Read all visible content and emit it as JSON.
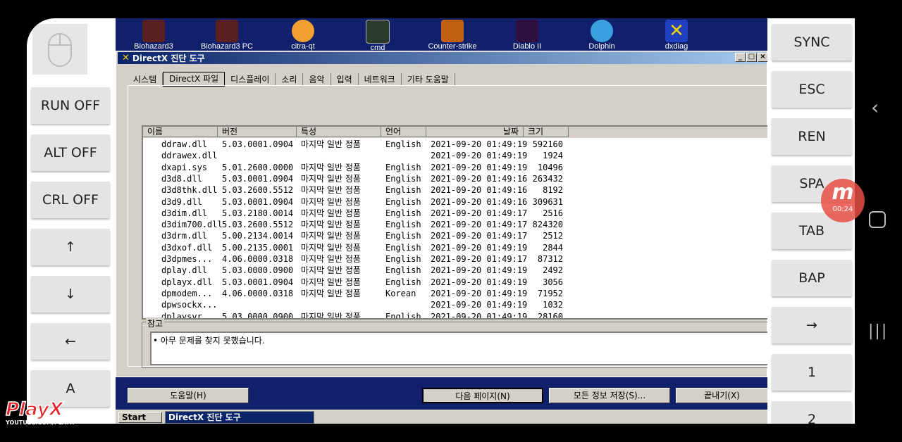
{
  "left_controls": {
    "buttons": [
      "RUN OFF",
      "ALT OFF",
      "CRL OFF",
      "↑",
      "↓",
      "←",
      "A"
    ]
  },
  "right_controls": {
    "buttons": [
      "SYNC",
      "ESC",
      "REN",
      "SPA",
      "TAB",
      "BAP",
      "→",
      "1",
      "2"
    ]
  },
  "desktop_icons": [
    "Biohazard3",
    "Biohazard3 PC",
    "citra-qt",
    "cmd",
    "Counter-strike",
    "Diablo II",
    "Dolphin",
    "dxdiag"
  ],
  "window": {
    "title": "DirectX 진단 도구",
    "tabs": [
      "시스템",
      "DirectX 파일",
      "디스플레이",
      "소리",
      "음악",
      "입력",
      "네트워크",
      "기타 도움말"
    ],
    "active_tab": "DirectX 파일",
    "columns": [
      "이름",
      "버전",
      "특성",
      "언어",
      "날짜",
      "크기"
    ],
    "files": [
      {
        "name": "ddraw.dll",
        "version": "5.03.0001.0904",
        "attr": "마지막 일반 정품",
        "lang": "English",
        "date": "2021-09-20 01:49:19",
        "size": "592160"
      },
      {
        "name": "ddrawex.dll",
        "version": "",
        "attr": "",
        "lang": "",
        "date": "2021-09-20 01:49:19",
        "size": "1924"
      },
      {
        "name": "dxapi.sys",
        "version": "5.01.2600.0000",
        "attr": "마지막 일반 정품",
        "lang": "English",
        "date": "2021-09-20 01:49:19",
        "size": "10496"
      },
      {
        "name": "d3d8.dll",
        "version": "5.03.0001.0904",
        "attr": "마지막 일반 정품",
        "lang": "English",
        "date": "2021-09-20 01:49:16",
        "size": "263432"
      },
      {
        "name": "d3d8thk.dll",
        "version": "5.03.2600.5512",
        "attr": "마지막 일반 정품",
        "lang": "English",
        "date": "2021-09-20 01:49:16",
        "size": "8192"
      },
      {
        "name": "d3d9.dll",
        "version": "5.03.0001.0904",
        "attr": "마지막 일반 정품",
        "lang": "English",
        "date": "2021-09-20 01:49:16",
        "size": "309631"
      },
      {
        "name": "d3dim.dll",
        "version": "5.03.2180.0014",
        "attr": "마지막 일반 정품",
        "lang": "English",
        "date": "2021-09-20 01:49:17",
        "size": "2516"
      },
      {
        "name": "d3dim700.dll",
        "version": "5.03.2600.5512",
        "attr": "마지막 일반 정품",
        "lang": "English",
        "date": "2021-09-20 01:49:17",
        "size": "824320"
      },
      {
        "name": "d3drm.dll",
        "version": "5.00.2134.0014",
        "attr": "마지막 일반 정품",
        "lang": "English",
        "date": "2021-09-20 01:49:17",
        "size": "2512"
      },
      {
        "name": "d3dxof.dll",
        "version": "5.00.2135.0001",
        "attr": "마지막 일반 정품",
        "lang": "English",
        "date": "2021-09-20 01:49:19",
        "size": "2844"
      },
      {
        "name": "d3dpmes...",
        "version": "4.06.0000.0318",
        "attr": "마지막 일반 정품",
        "lang": "English",
        "date": "2021-09-20 01:49:17",
        "size": "87312"
      },
      {
        "name": "dplay.dll",
        "version": "5.03.0000.0900",
        "attr": "마지막 일반 정품",
        "lang": "English",
        "date": "2021-09-20 01:49:19",
        "size": "2492"
      },
      {
        "name": "dplayx.dll",
        "version": "5.03.0001.0904",
        "attr": "마지막 일반 정품",
        "lang": "English",
        "date": "2021-09-20 01:49:19",
        "size": "3056"
      },
      {
        "name": "dpmodem...",
        "version": "4.06.0000.0318",
        "attr": "마지막 일반 정품",
        "lang": "Korean",
        "date": "2021-09-20 01:49:19",
        "size": "71952"
      },
      {
        "name": "dpwsockx...",
        "version": "",
        "attr": "",
        "lang": "",
        "date": "2021-09-20 01:49:19",
        "size": "1032"
      },
      {
        "name": "dplaysvr...",
        "version": "5.03.0000.0900",
        "attr": "마지막 일반 정품",
        "lang": "English",
        "date": "2021-09-20 01:49:19",
        "size": "28160"
      }
    ],
    "notes_label": "참고",
    "notes_text": "• 아무 문제를 찾지 못했습니다.",
    "help_button": "도움말(H)",
    "next_button": "다음 페이지(N)",
    "save_button": "모든 정보 저장(S)...",
    "exit_button": "끝내기(X)"
  },
  "taskbar": {
    "start": "Start",
    "task": "DirectX 진단 도구"
  },
  "recorder": {
    "time": "00:24"
  },
  "watermark": {
    "logo": "PlayX",
    "url": "YOUTUBE.COM/PLAYX"
  },
  "colors": {
    "desktop": "#10206a",
    "titlebar": "#0a246a",
    "face": "#d4d0c8",
    "recorder": "#e65046"
  }
}
